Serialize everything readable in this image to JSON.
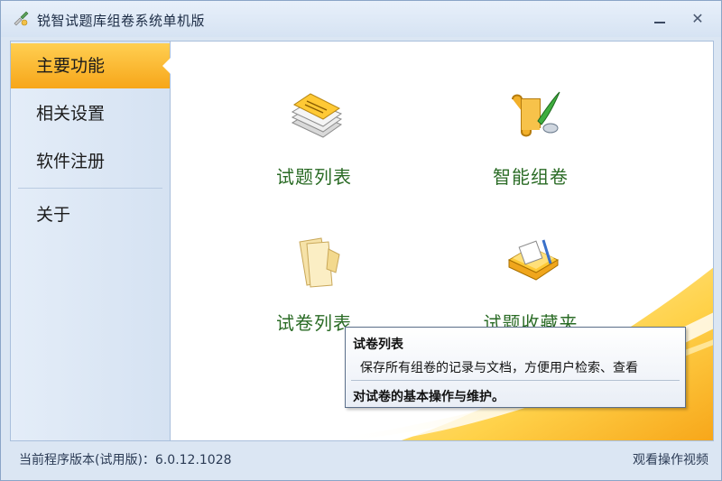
{
  "window": {
    "title": "锐智试题库组卷系统单机版",
    "minimize_glyph": "",
    "close_glyph": "✕"
  },
  "sidebar": {
    "items": [
      {
        "label": "主要功能",
        "active": true
      },
      {
        "label": "相关设置",
        "active": false
      },
      {
        "label": "软件注册",
        "active": false
      },
      {
        "label": "关于",
        "active": false
      }
    ]
  },
  "tiles": [
    {
      "label": "试题列表",
      "icon": "stack-of-papers-icon"
    },
    {
      "label": "智能组卷",
      "icon": "scroll-and-quill-icon"
    },
    {
      "label": "试卷列表",
      "icon": "paper-sheets-icon"
    },
    {
      "label": "试题收藏夹",
      "icon": "folder-with-documents-icon"
    }
  ],
  "tooltip": {
    "title": "试卷列表",
    "line1": "保存所有组卷的记录与文档，方便用户检索、查看",
    "line2": "对试卷的基本操作与维护。"
  },
  "status": {
    "version_text": "当前程序版本(试用版)：6.0.12.1028",
    "video_link": "观看操作视频"
  },
  "colors": {
    "accent": "#f7a619",
    "tile_label": "#2a6b25"
  }
}
